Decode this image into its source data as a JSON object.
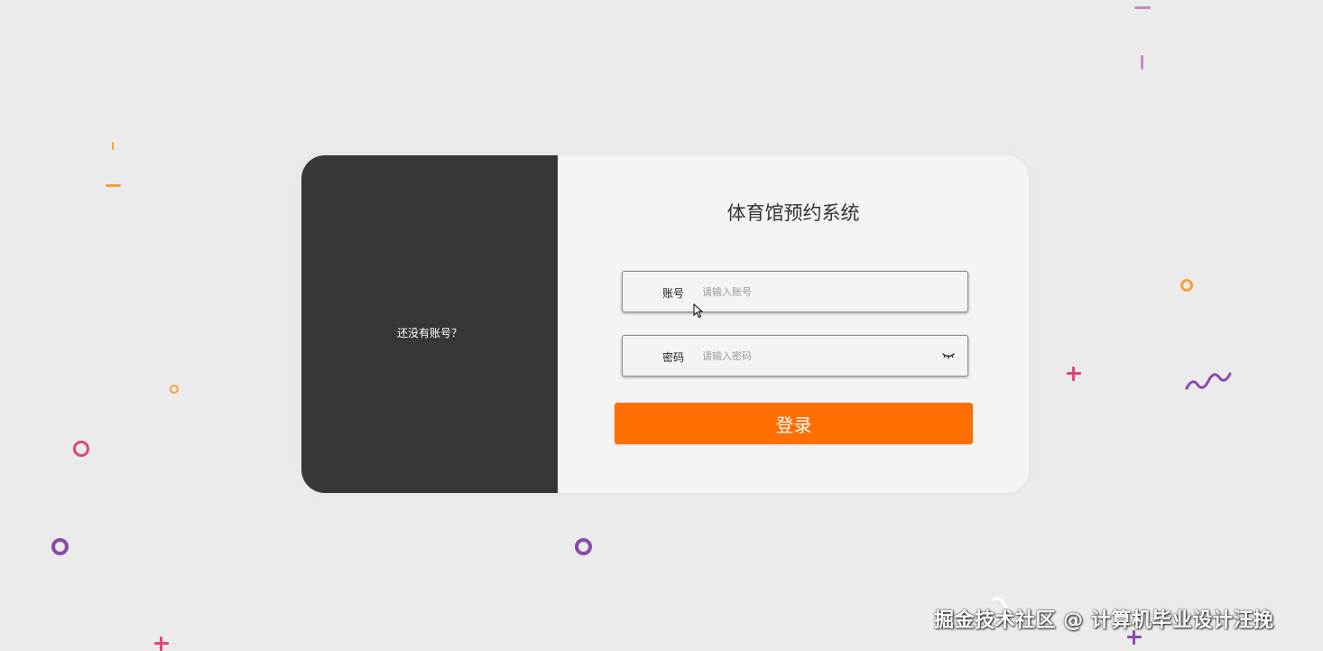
{
  "left_panel": {
    "no_account_text": "还没有账号？"
  },
  "form": {
    "title": "体育馆预约系统",
    "account": {
      "label": "账号",
      "placeholder": "请输入账号",
      "value": ""
    },
    "password": {
      "label": "密码",
      "placeholder": "请输入密码",
      "value": "",
      "toggle_icon": "eye-closed-icon"
    },
    "login_button_label": "登录"
  },
  "watermark": "掘金技术社区 @ 计算机毕业设计汪挽",
  "colors": {
    "background": "#ebebeb",
    "left_panel": "#373737",
    "right_panel": "#f4f4f3",
    "login_button": "#ff6e00",
    "confetti_orange": "#f5a23a",
    "confetti_pink": "#e0457b",
    "confetti_purple": "#8a4aa8"
  }
}
